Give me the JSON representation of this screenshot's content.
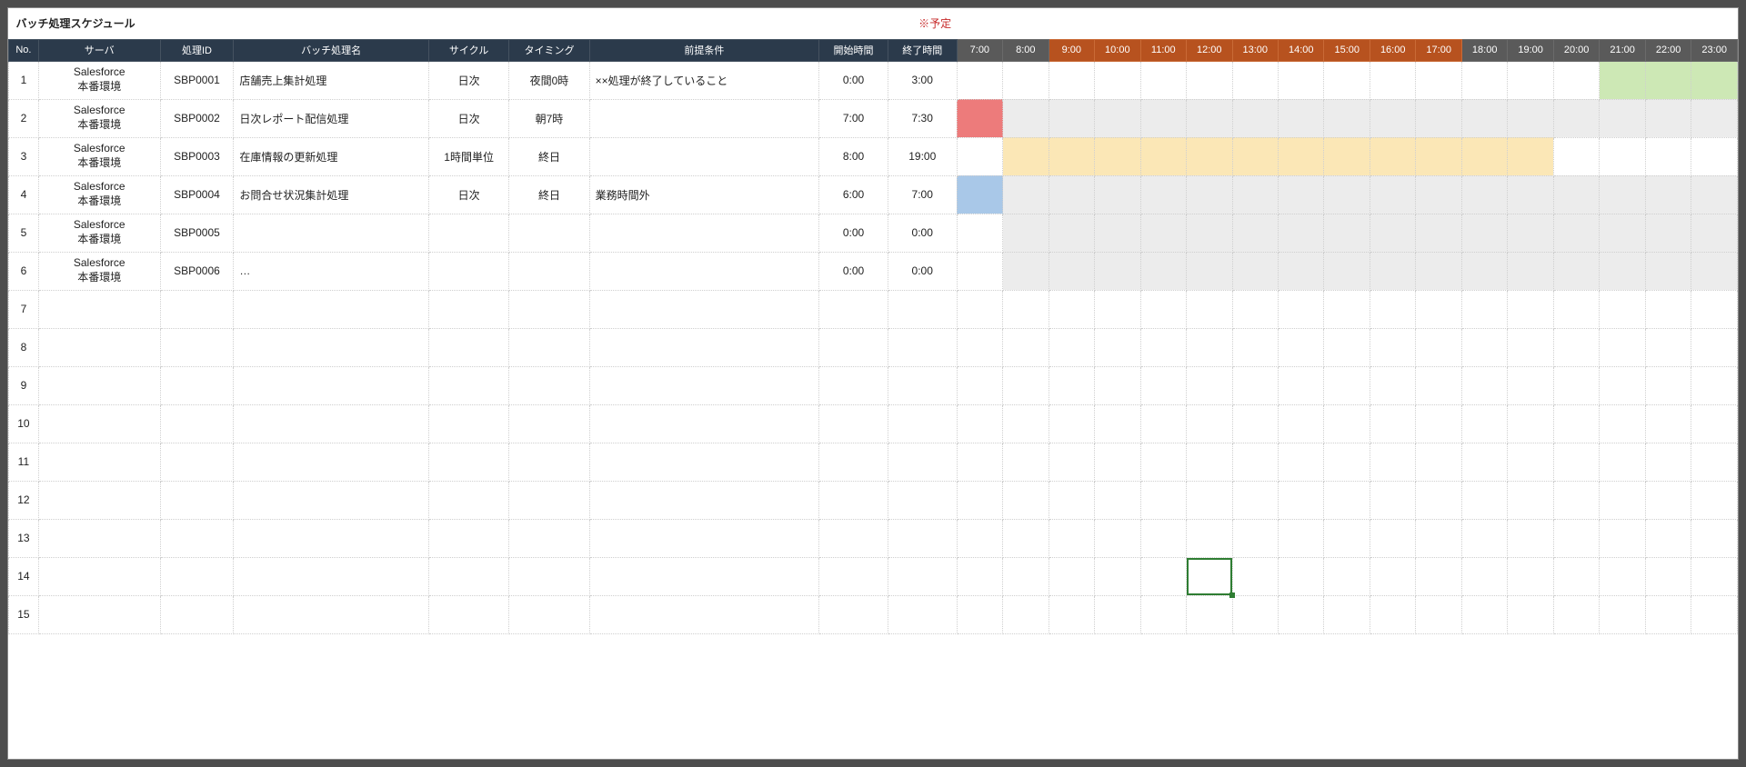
{
  "title": "バッチ処理スケジュール",
  "note": "※予定",
  "columns": {
    "no": "No.",
    "server": "サーバ",
    "procId": "処理ID",
    "procName": "バッチ処理名",
    "cycle": "サイクル",
    "timing": "タイミング",
    "cond": "前提条件",
    "start": "開始時間",
    "end": "終了時間"
  },
  "hours": [
    {
      "label": "7:00",
      "style": "dk"
    },
    {
      "label": "8:00",
      "style": "dk"
    },
    {
      "label": "9:00",
      "style": "or"
    },
    {
      "label": "10:00",
      "style": "or"
    },
    {
      "label": "11:00",
      "style": "or"
    },
    {
      "label": "12:00",
      "style": "or"
    },
    {
      "label": "13:00",
      "style": "or"
    },
    {
      "label": "14:00",
      "style": "or"
    },
    {
      "label": "15:00",
      "style": "or"
    },
    {
      "label": "16:00",
      "style": "or"
    },
    {
      "label": "17:00",
      "style": "or"
    },
    {
      "label": "18:00",
      "style": "dk"
    },
    {
      "label": "19:00",
      "style": "dk"
    },
    {
      "label": "20:00",
      "style": "dk"
    },
    {
      "label": "21:00",
      "style": "dk"
    },
    {
      "label": "22:00",
      "style": "dk"
    },
    {
      "label": "23:00",
      "style": "dk"
    }
  ],
  "rows": [
    {
      "no": "1",
      "server": "Salesforce\n本番環境",
      "procId": "SBP0001",
      "procName": "店舗売上集計処理",
      "cycle": "日次",
      "timing": "夜間0時",
      "cond": "××処理が終了していること",
      "start": "0:00",
      "end": "3:00",
      "gantt": {
        "fills": [
          {
            "from": 21,
            "to": 24,
            "color": "green"
          }
        ],
        "shade": false
      }
    },
    {
      "no": "2",
      "server": "Salesforce\n本番環境",
      "procId": "SBP0002",
      "procName": "日次レポート配信処理",
      "cycle": "日次",
      "timing": "朝7時",
      "cond": "",
      "start": "7:00",
      "end": "7:30",
      "gantt": {
        "fills": [
          {
            "from": 7,
            "to": 8,
            "color": "red"
          }
        ],
        "shade": true
      }
    },
    {
      "no": "3",
      "server": "Salesforce\n本番環境",
      "procId": "SBP0003",
      "procName": "在庫情報の更新処理",
      "cycle": "1時間単位",
      "timing": "終日",
      "cond": "",
      "start": "8:00",
      "end": "19:00",
      "gantt": {
        "fills": [
          {
            "from": 8,
            "to": 20,
            "color": "yellow"
          }
        ],
        "shade": false
      }
    },
    {
      "no": "4",
      "server": "Salesforce\n本番環境",
      "procId": "SBP0004",
      "procName": "お問合せ状況集計処理",
      "cycle": "日次",
      "timing": "終日",
      "cond": "業務時間外",
      "start": "6:00",
      "end": "7:00",
      "gantt": {
        "fills": [
          {
            "from": 7,
            "to": 8,
            "color": "blue"
          }
        ],
        "shade": true
      }
    },
    {
      "no": "5",
      "server": "Salesforce\n本番環境",
      "procId": "SBP0005",
      "procName": "",
      "cycle": "",
      "timing": "",
      "cond": "",
      "start": "0:00",
      "end": "0:00",
      "gantt": {
        "fills": [],
        "shade": true,
        "shadeFrom": 8
      }
    },
    {
      "no": "6",
      "server": "Salesforce\n本番環境",
      "procId": "SBP0006",
      "procName": "…",
      "cycle": "",
      "timing": "",
      "cond": "",
      "start": "0:00",
      "end": "0:00",
      "gantt": {
        "fills": [],
        "shade": true,
        "shadeFrom": 8
      }
    },
    {
      "no": "7"
    },
    {
      "no": "8"
    },
    {
      "no": "9"
    },
    {
      "no": "10"
    },
    {
      "no": "11"
    },
    {
      "no": "12"
    },
    {
      "no": "13"
    },
    {
      "no": "14"
    },
    {
      "no": "15"
    }
  ],
  "selected": {
    "row": 14,
    "hourIndex": 5
  },
  "chart_data": {
    "type": "gantt",
    "x_hours": [
      7,
      8,
      9,
      10,
      11,
      12,
      13,
      14,
      15,
      16,
      17,
      18,
      19,
      20,
      21,
      22,
      23
    ],
    "business_hours": {
      "start": 9,
      "end": 18
    },
    "series": [
      {
        "name": "店舗売上集計処理",
        "procId": "SBP0001",
        "start": "0:00",
        "end": "3:00",
        "color": "green",
        "wrap_next_day": true,
        "bar_hours": [
          21,
          22,
          23
        ]
      },
      {
        "name": "日次レポート配信処理",
        "procId": "SBP0002",
        "start": "7:00",
        "end": "7:30",
        "color": "red",
        "bar_hours": [
          7
        ]
      },
      {
        "name": "在庫情報の更新処理",
        "procId": "SBP0003",
        "start": "8:00",
        "end": "19:00",
        "color": "yellow",
        "bar_hours": [
          8,
          9,
          10,
          11,
          12,
          13,
          14,
          15,
          16,
          17,
          18,
          19
        ]
      },
      {
        "name": "お問合せ状況集計処理",
        "procId": "SBP0004",
        "start": "6:00",
        "end": "7:00",
        "color": "blue",
        "bar_hours": [
          7
        ]
      }
    ]
  }
}
